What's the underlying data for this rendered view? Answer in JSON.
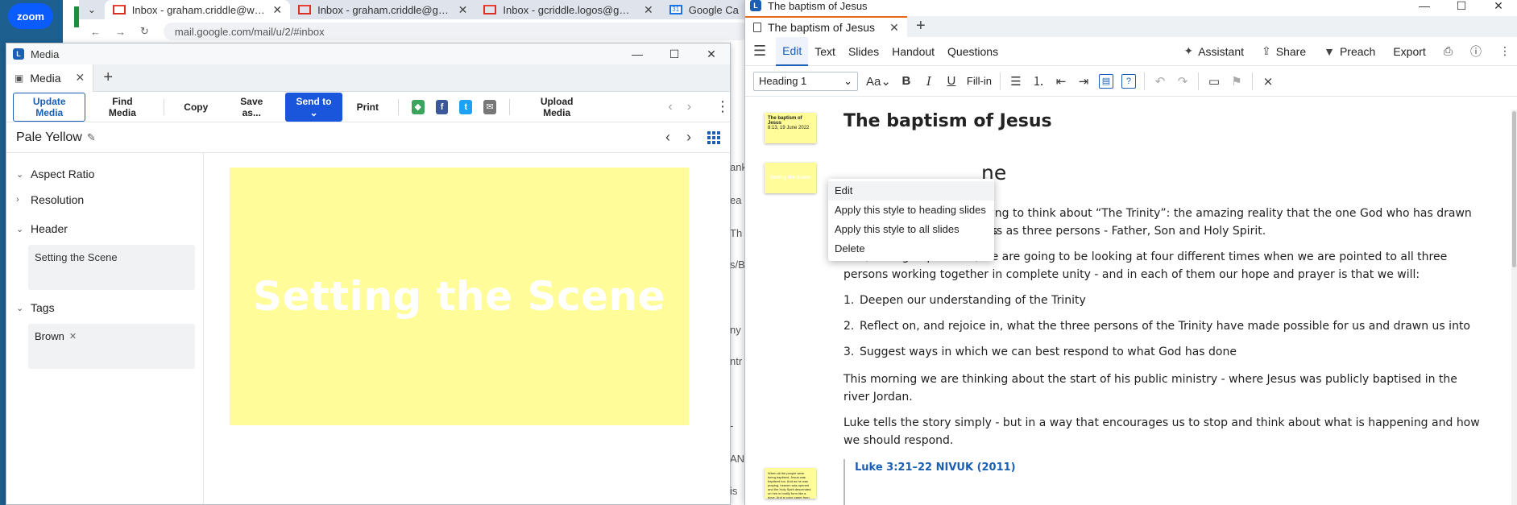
{
  "desktop": {
    "zoom_label": "zoom"
  },
  "browser": {
    "tabs": [
      {
        "title": "Inbox - graham.criddle@wscf"
      },
      {
        "title": "Inbox - graham.criddle@gmail"
      },
      {
        "title": "Inbox - gcriddle.logos@gmail."
      },
      {
        "title": "Google Ca"
      }
    ],
    "url": "mail.google.com/mail/u/2/#inbox",
    "bleed": [
      "ank",
      "ea",
      "Th",
      "s/B",
      "ny",
      "ntr",
      "-",
      "AN",
      "is"
    ]
  },
  "media": {
    "window_title": "Media",
    "tab_label": "Media",
    "toolbar": {
      "update_media": "Update Media",
      "find_media": "Find Media",
      "copy": "Copy",
      "save_as": "Save as...",
      "send_to": "Send to",
      "print": "Print",
      "upload_media": "Upload Media"
    },
    "style_name": "Pale Yellow",
    "sections": {
      "aspect_ratio": "Aspect Ratio",
      "resolution": "Resolution",
      "header": "Header",
      "tags": "Tags"
    },
    "header_value": "Setting the Scene",
    "tag": "Brown",
    "preview_text": "Setting the Scene",
    "preview_color": "#fffc99"
  },
  "sermon": {
    "window_title": "The baptism of Jesus",
    "tab_label": "The baptism of Jesus",
    "menu": [
      "Edit",
      "Text",
      "Slides",
      "Handout",
      "Questions"
    ],
    "right_menu": {
      "assistant": "Assistant",
      "share": "Share",
      "preach": "Preach",
      "export": "Export"
    },
    "style_select": "Heading 1",
    "fill_in": "Fill-in",
    "title": "The baptism of Jesus",
    "heading2_tail": "ne",
    "intro_line1": "uing to think about “The Trinity”: the amazing reality that the one God who has drawn us",
    "intro_line2": "rks as three persons - Father, Son and Holy Spirit.",
    "para2": "And, during September, we are going to be looking at four different times when we are pointed to all three persons working together in complete unity - and in each of them our hope and prayer is that we will:",
    "list": [
      {
        "n": "1.",
        "text": "Deepen our understanding of the Trinity"
      },
      {
        "n": "2.",
        "text": "Reflect on, and rejoice in, what the three persons of the Trinity have made possible for us and drawn us into"
      },
      {
        "n": "3.",
        "text": "Suggest ways in which we can best respond to what God has done"
      }
    ],
    "para3": "This morning we are thinking about the start of his public ministry - where Jesus was publicly baptised in the river Jordan.",
    "para4": "Luke tells the story simply - but in a way that encourages us to stop and think about what is happening and how we should respond.",
    "scripture_ref": "Luke 3:21–22 NIVUK (2011)",
    "thumb1_title": "The baptism of Jesus",
    "thumb1_sub": "8:13, 19 June 2022",
    "thumb2_text": "Setting the Scene",
    "thumb3_text": "When all the people were being baptised, Jesus was baptised too. And as he was praying, heaven was opened and the Holy Spirit descended on him in bodily form like a dove. And a voice came from heaven: 'You are my Son, whom I love; with you I am well pleased.'"
  },
  "context_menu": {
    "items": [
      "Edit",
      "Apply this style to heading slides",
      "Apply this style to all slides",
      "Delete"
    ]
  }
}
